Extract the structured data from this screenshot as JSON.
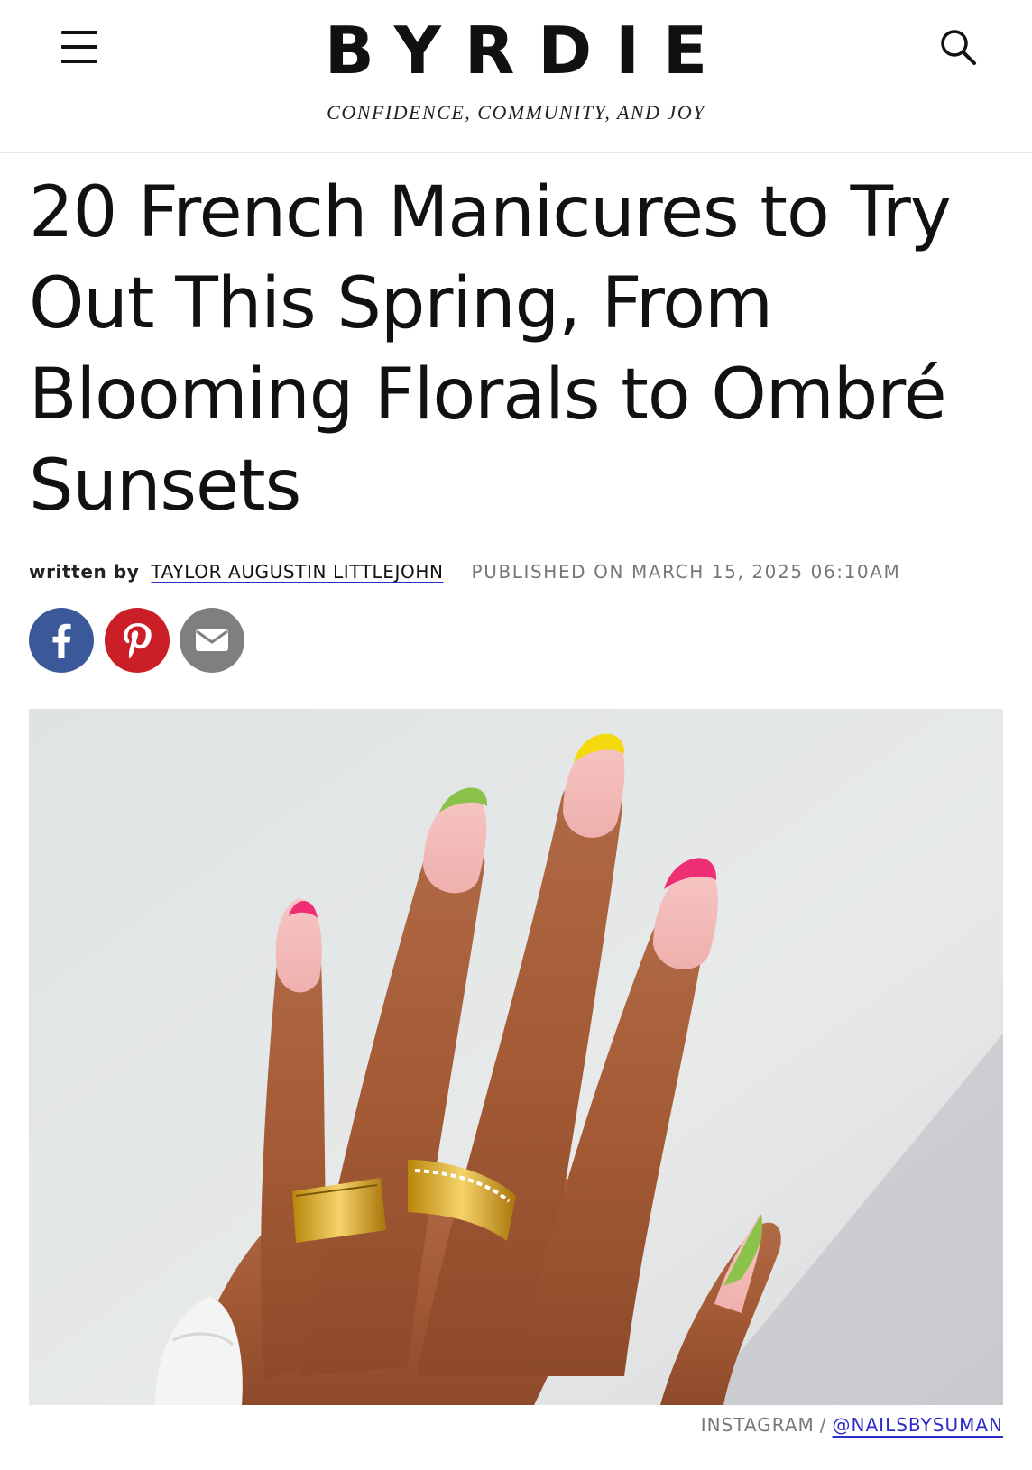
{
  "header": {
    "logo": "BYRDIE",
    "tagline": "CONFIDENCE, COMMUNITY, AND JOY",
    "menu_icon": "hamburger-menu-icon",
    "search_icon": "search-icon"
  },
  "article": {
    "headline": "20 French Manicures to Try Out This Spring, From Blooming Florals to Ombré Sunsets",
    "byline_prefix": "written by",
    "author": "TAYLOR AUGUSTIN LITTLEJOHN",
    "published": "PUBLISHED ON MARCH 15, 2025 06:10AM"
  },
  "share": {
    "facebook_icon": "facebook-icon",
    "pinterest_icon": "pinterest-icon",
    "email_icon": "email-icon",
    "colors": {
      "facebook": "#3b5998",
      "pinterest": "#cb1f27",
      "email": "#7f7f7f"
    }
  },
  "image": {
    "credit_source": "INSTAGRAM",
    "credit_separator": "/",
    "credit_handle": "@NAILSBYSUMAN"
  }
}
